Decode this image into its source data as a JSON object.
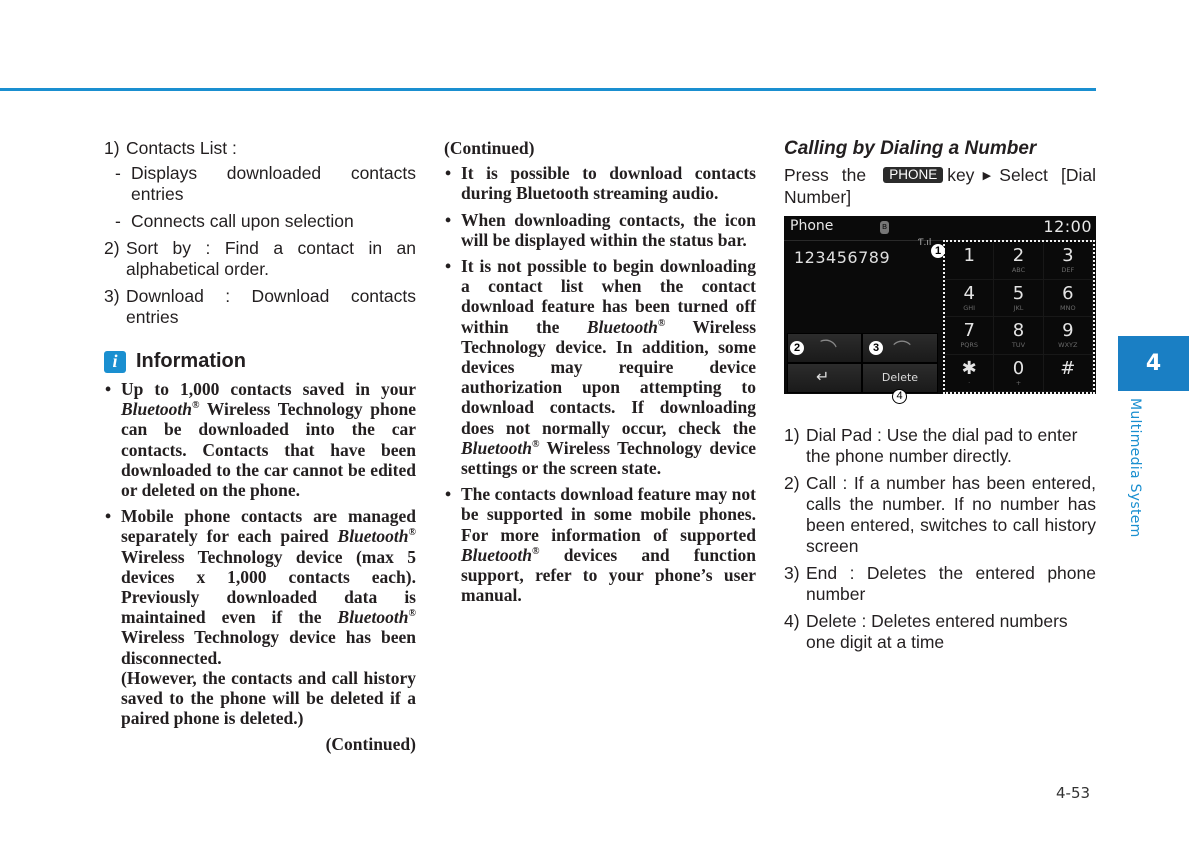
{
  "page": {
    "chapter_number": "4",
    "chapter_title": "Multimedia System",
    "page_number": "4-53",
    "accent_color": "#1a8fd0"
  },
  "col1": {
    "items": [
      {
        "num": "1)",
        "text": "Contacts List :"
      },
      {
        "num": "2)",
        "text": "Sort by : Find a contact in an alphabetical order."
      },
      {
        "num": "3)",
        "text": "Download : Download contacts entries"
      }
    ],
    "subitems": [
      "Displays downloaded contacts entries",
      "Connects call upon selection"
    ],
    "info": {
      "icon": "i",
      "title": "Information",
      "bullet1": {
        "a": "Up to 1,000 contacts saved in your ",
        "bt": "Bluetooth",
        "reg": "®",
        "b": " Wireless Technology phone can be downloaded into the car contacts. Contacts that have been downloaded to the car cannot be edited or deleted on the phone."
      },
      "bullet2": {
        "a": "Mobile phone contacts are managed separately for each paired ",
        "bt1": "Bluetooth",
        "reg": "®",
        "b": " Wireless Technology device (max 5 devices x 1,000 contacts each). Previously downloaded data is maintained even if the ",
        "bt2": "Bluetooth",
        "c": " Wireless Technology device has been disconnected.",
        "note": "(However, the contacts and call history saved to the phone will be deleted if a paired phone is deleted.)"
      },
      "continued": "(Continued)"
    }
  },
  "col2": {
    "continued": "(Continued)",
    "bullet1": "It is possible to download contacts during Bluetooth streaming audio.",
    "bullet2": "When downloading contacts, the icon will be displayed within the status bar.",
    "bullet3": {
      "a": "It is not possible to begin downloading a contact list when the contact download feature has been turned off within the ",
      "bt": "Bluetooth",
      "reg": "®",
      "b": " Wireless Technology device. In addition, some devices may require device authorization upon attempting to download contacts. If downloading does not normally occur, check the ",
      "bt2": "Bluetooth",
      "c": " Wireless Technology device settings or the screen state."
    },
    "bullet4": {
      "a": "The contacts download feature may not be supported in some mobile phones. For more information of supported ",
      "bt": "Bluetooth",
      "reg": "®",
      "b": " devices and function support, refer to your phone’s user manual."
    }
  },
  "col3": {
    "title": "Calling by Dialing a Number",
    "instr_a": "Press the",
    "key": "PHONE",
    "instr_b": "key",
    "arrow": "▶",
    "instr_c": "Select [Dial Number]",
    "screen": {
      "title": "Phone",
      "bt_icon": "ʙ",
      "time": "12:00",
      "number": "123456789",
      "signal": "Ƭ.ıl",
      "delete_label": "Delete",
      "keys": [
        {
          "d": "1",
          "l": ""
        },
        {
          "d": "2",
          "l": "ABC"
        },
        {
          "d": "3",
          "l": "DEF"
        },
        {
          "d": "4",
          "l": "GHI"
        },
        {
          "d": "5",
          "l": "JKL"
        },
        {
          "d": "6",
          "l": "MNO"
        },
        {
          "d": "7",
          "l": "PQRS"
        },
        {
          "d": "8",
          "l": "TUV"
        },
        {
          "d": "9",
          "l": "WXYZ"
        },
        {
          "d": "✱",
          "l": "·"
        },
        {
          "d": "0",
          "l": "+"
        },
        {
          "d": "#",
          "l": ""
        }
      ],
      "callouts": [
        "1",
        "2",
        "3",
        "4"
      ]
    },
    "items": [
      {
        "num": "1)",
        "text": "Dial Pad : Use the dial pad to enter the phone number directly."
      },
      {
        "num": "2)",
        "text": "Call : If a number has been entered, calls the number. If no number has been entered, switches to call history screen"
      },
      {
        "num": "3)",
        "text": "End : Deletes the entered phone number"
      },
      {
        "num": "4)",
        "text": "Delete : Deletes entered numbers one digit at a time"
      }
    ]
  }
}
